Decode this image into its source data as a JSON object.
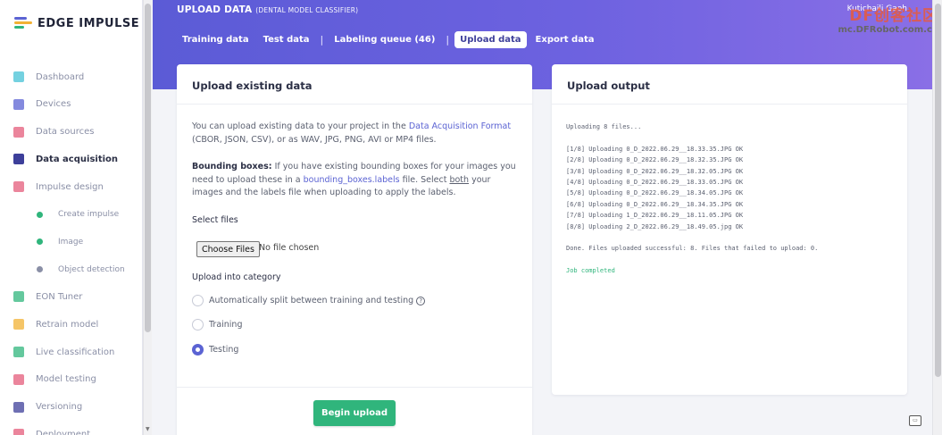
{
  "app": {
    "logo_text": "EDGE IMPULSE",
    "brand_colors": {
      "accent": "#5b5bd6",
      "green": "#30b57c",
      "link": "#5b63d3"
    }
  },
  "sidebar": {
    "items": [
      {
        "label": "Dashboard",
        "icon": "monitor-icon",
        "color": "#46c1d6"
      },
      {
        "label": "Devices",
        "icon": "chip-icon",
        "color": "#5b63d3"
      },
      {
        "label": "Data sources",
        "icon": "wand-icon",
        "color": "#e45c7b"
      },
      {
        "label": "Data acquisition",
        "icon": "database-icon",
        "color": "#3d3f9a",
        "active": true
      },
      {
        "label": "Impulse design",
        "icon": "pulse-icon",
        "color": "#e45c7b"
      },
      {
        "label": "Create impulse",
        "icon": "dot-icon",
        "color": "#30b57c",
        "sub": true
      },
      {
        "label": "Image",
        "icon": "dot-icon",
        "color": "#30b57c",
        "sub": true
      },
      {
        "label": "Object detection",
        "icon": "dot-icon",
        "color": "#8a8fa6",
        "sub": true
      },
      {
        "label": "EON Tuner",
        "icon": "tuner-icon",
        "color": "#30b57c"
      },
      {
        "label": "Retrain model",
        "icon": "shuffle-icon",
        "color": "#f2b134"
      },
      {
        "label": "Live classification",
        "icon": "network-icon",
        "color": "#30b57c"
      },
      {
        "label": "Model testing",
        "icon": "clipboard-icon",
        "color": "#e45c7b"
      },
      {
        "label": "Versioning",
        "icon": "branch-icon",
        "color": "#3d3f9a"
      },
      {
        "label": "Deployment",
        "icon": "rocket-icon",
        "color": "#e45c7b"
      }
    ]
  },
  "header": {
    "title": "UPLOAD DATA",
    "subtitle": "(DENTAL MODEL CLASSIFIER)",
    "user": "Kutichaili Gaoh",
    "tabs": [
      {
        "label": "Training data"
      },
      {
        "label": "Test data"
      },
      {
        "label": "Labeling queue (46)"
      },
      {
        "label": "Upload data",
        "active": true
      },
      {
        "label": "Export data"
      }
    ]
  },
  "watermark": {
    "top": "DF创客社区",
    "url": "mc.DFRobot.com.cn"
  },
  "upload_card": {
    "title": "Upload existing data",
    "intro_1": "You can upload existing data to your project in the ",
    "intro_link": "Data Acquisition Format",
    "intro_2": "(CBOR, JSON, CSV), or as WAV, JPG, PNG, AVI or MP4 files.",
    "bbox_bold": "Bounding boxes:",
    "bbox_1": " If you have existing bounding boxes for your images you need to upload these in a ",
    "bbox_link": "bounding_boxes.labels",
    "bbox_2": " file. Select ",
    "bbox_both": "both",
    "bbox_3": " your images and the labels file when uploading to apply the labels.",
    "select_files_label": "Select files",
    "choose_files_button": "Choose Files",
    "no_file_text": "No file chosen",
    "category_label": "Upload into category",
    "options": [
      {
        "label": "Automatically split between training and testing",
        "selected": false
      },
      {
        "label": "Training",
        "selected": false
      },
      {
        "label": "Testing",
        "selected": true
      }
    ],
    "begin_upload_button": "Begin upload"
  },
  "output_card": {
    "title": "Upload output",
    "lines": [
      "Uploading 8 files...",
      "",
      "[1/8] Uploading 0_D_2022.06.29__18.33.35.JPG OK",
      "[2/8] Uploading 0_D_2022.06.29__18.32.35.JPG OK",
      "[3/8] Uploading 0_D_2022.06.29__18.32.05.JPG OK",
      "[4/8] Uploading 0_D_2022.06.29__18.33.05.JPG OK",
      "[5/8] Uploading 0_D_2022.06.29__18.34.05.JPG OK",
      "[6/8] Uploading 0_D_2022.06.29__18.34.35.JPG OK",
      "[7/8] Uploading 1_D_2022.06.29__18.11.05.JPG OK",
      "[8/8] Uploading 2_D_2022.06.29__18.49.05.jpg OK",
      "",
      "Done. Files uploaded successful: 8. Files that failed to upload: 0.",
      "",
      "Job completed"
    ]
  }
}
